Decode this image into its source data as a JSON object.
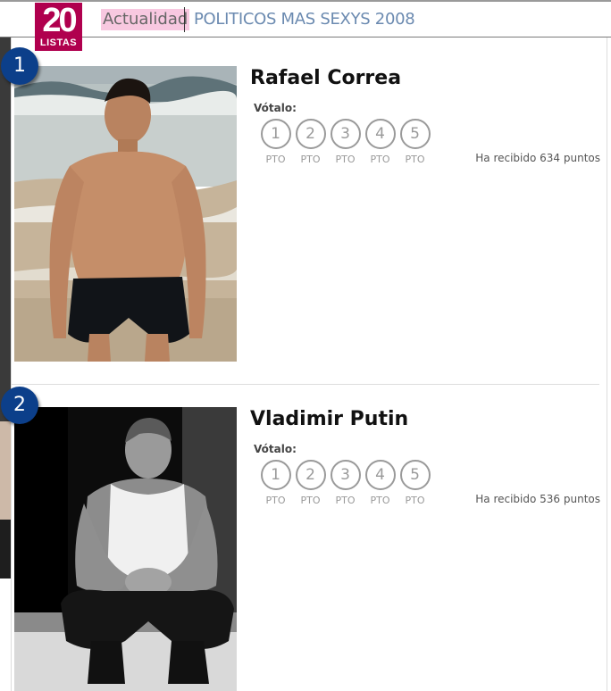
{
  "header": {
    "logo_number": "20",
    "logo_word": "LISTAS",
    "category": "Actualidad",
    "list_title": "POLITICOS MAS SEXYS 2008"
  },
  "colors": {
    "brand": "#b0004e",
    "rank_badge": "#0c3f8a",
    "category_highlight": "#f8c8e0",
    "title_link": "#6b8ab0"
  },
  "items": [
    {
      "rank": "1",
      "name": "Rafael Correa",
      "vote_label": "Vótalo:",
      "vote_options": [
        "1",
        "2",
        "3",
        "4",
        "5"
      ],
      "vote_unit": "PTO",
      "points_text": "Ha recibido 634 puntos"
    },
    {
      "rank": "2",
      "name": "Vladimir Putin",
      "vote_label": "Vótalo:",
      "vote_options": [
        "1",
        "2",
        "3",
        "4",
        "5"
      ],
      "vote_unit": "PTO",
      "points_text": "Ha recibido 536 puntos"
    }
  ]
}
